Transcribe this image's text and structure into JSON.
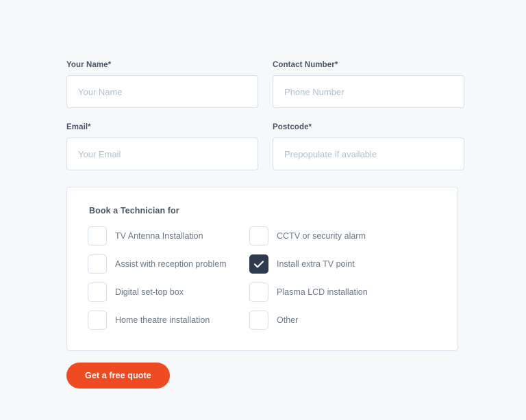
{
  "theme": {
    "page_background": "#f6f8fa",
    "label_color": "#4a5568",
    "placeholder_color": "#b2c1d1",
    "input_border": "#d4dfe9",
    "panel_border": "#dbe4ee",
    "checkbox_checked_background": "#2d3a4f",
    "button_background": "#ee4b22",
    "button_text_color": "#ffffff"
  },
  "form": {
    "fields": [
      {
        "name": "your-name",
        "label": "Your Name*",
        "placeholder": "Your Name",
        "value": ""
      },
      {
        "name": "contact-number",
        "label": "Contact Number*",
        "placeholder": "Phone Number",
        "value": ""
      },
      {
        "name": "email",
        "label": "Email*",
        "placeholder": "Your Email",
        "value": ""
      },
      {
        "name": "postcode",
        "label": "Postcode*",
        "placeholder": "Prepopulate if available",
        "value": ""
      }
    ],
    "technician_panel": {
      "title": "Book a Technician for",
      "options": [
        {
          "name": "tv-antenna-installation",
          "label": "TV Antenna Installation",
          "checked": false,
          "column": "left"
        },
        {
          "name": "cctv-or-security-alarm",
          "label": "CCTV or security alarm",
          "checked": false,
          "column": "right"
        },
        {
          "name": "assist-with-reception-problem",
          "label": "Assist with reception problem",
          "checked": false,
          "column": "left"
        },
        {
          "name": "install-extra-tv-point",
          "label": "Install extra TV point",
          "checked": true,
          "column": "right"
        },
        {
          "name": "digital-set-top-box",
          "label": "Digital set-top box",
          "checked": false,
          "column": "left"
        },
        {
          "name": "plasma-lcd-installation",
          "label": "Plasma LCD installation",
          "checked": false,
          "column": "right"
        },
        {
          "name": "home-theatre-installation",
          "label": "Home theatre installation",
          "checked": false,
          "column": "left"
        },
        {
          "name": "other",
          "label": "Other",
          "checked": false,
          "column": "right"
        }
      ],
      "checked_icon": "check-icon"
    },
    "submit": {
      "label": "Get a free quote"
    }
  }
}
